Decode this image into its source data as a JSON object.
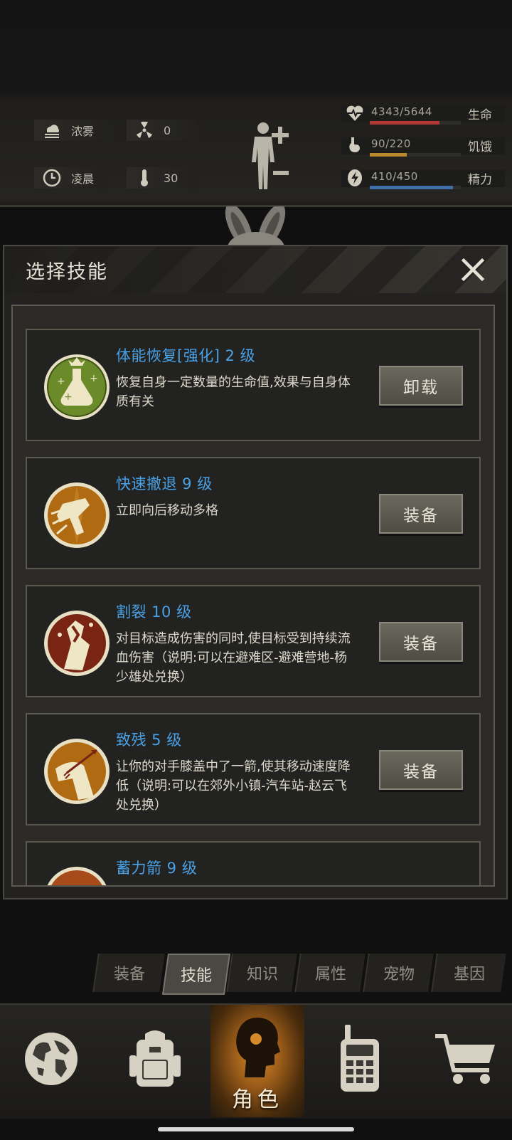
{
  "status": {
    "weather": "浓雾",
    "radiation": "0",
    "time_of_day": "凌晨",
    "temperature": "30",
    "health": {
      "value": "4343/5644",
      "label": "生命",
      "fraction": 0.769,
      "color": "#b43a35"
    },
    "hunger": {
      "value": "90/220",
      "label": "饥饿",
      "fraction": 0.409,
      "color": "#b8872f"
    },
    "energy": {
      "value": "410/450",
      "label": "精力",
      "fraction": 0.911,
      "color": "#3f6ea8"
    }
  },
  "dialog": {
    "title": "选择技能",
    "skills": [
      {
        "name": "体能恢复[强化] 2 级",
        "desc": "恢复自身一定数量的生命值,效果与自身体质有关",
        "button": "卸载",
        "icon": "potion-icon"
      },
      {
        "name": "快速撤退 9 级",
        "desc": "立即向后移动多格",
        "button": "装备",
        "icon": "retreat-icon"
      },
      {
        "name": "割裂 10 级",
        "desc": "对目标造成伤害的同时,使目标受到持续流血伤害（说明:可以在避难区-避难营地-杨少雄处兑换）",
        "button": "装备",
        "icon": "bleed-icon"
      },
      {
        "name": "致残 5 级",
        "desc": "让你的对手膝盖中了一箭,使其移动速度降低（说明:可以在郊外小镇-汽车站-赵云飞处兑换）",
        "button": "装备",
        "icon": "arrow-knee-icon"
      },
      {
        "name": "蓄力箭 9 级",
        "desc": "",
        "button": "",
        "icon": "charged-arrow-icon"
      }
    ]
  },
  "tabs": [
    "装备",
    "技能",
    "知识",
    "属性",
    "宠物",
    "基因"
  ],
  "active_tab": "技能",
  "nav": {
    "role_label": "角色"
  }
}
